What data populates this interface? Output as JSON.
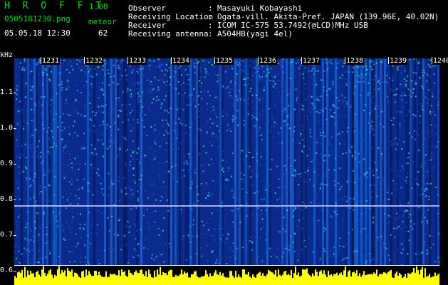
{
  "header": {
    "app_title": "H R O F F T",
    "app_version": "1.00",
    "filename": "0505181230.png",
    "datetime": "05.05.18 12:30",
    "meteor_label": "meteor",
    "meteor_count": "62"
  },
  "info": [
    {
      "key": "Observer",
      "colon": ":",
      "value": "Masayuki Kobayashi"
    },
    {
      "key": "Receiving Location",
      "colon": ":",
      "value": "Ogata-vill. Akita-Pref. JAPAN (139.96E, 40.02N)"
    },
    {
      "key": "Receiver",
      "colon": ":",
      "value": "ICOM IC-575 53.7492(@LCD)MHz USB"
    },
    {
      "key": "Receiving antenna",
      "colon": ":",
      "value": "A504HB(yagi 4el)"
    }
  ],
  "spectrogram": {
    "y_unit": "kHz",
    "y_ticks": [
      "1.1",
      "1.0",
      "0.9",
      "0.8",
      "0.7",
      "0.6"
    ],
    "x_ticks": [
      "1231",
      "1232",
      "1233",
      "1234",
      "1235",
      "1236",
      "1237",
      "1238",
      "1239",
      "1240"
    ],
    "colors": {
      "bg": "#0a2a8c",
      "mid": "#1060d0",
      "hot": "#20d0a0",
      "line": "#d0d0ff",
      "bars": "#ffff00"
    }
  }
}
